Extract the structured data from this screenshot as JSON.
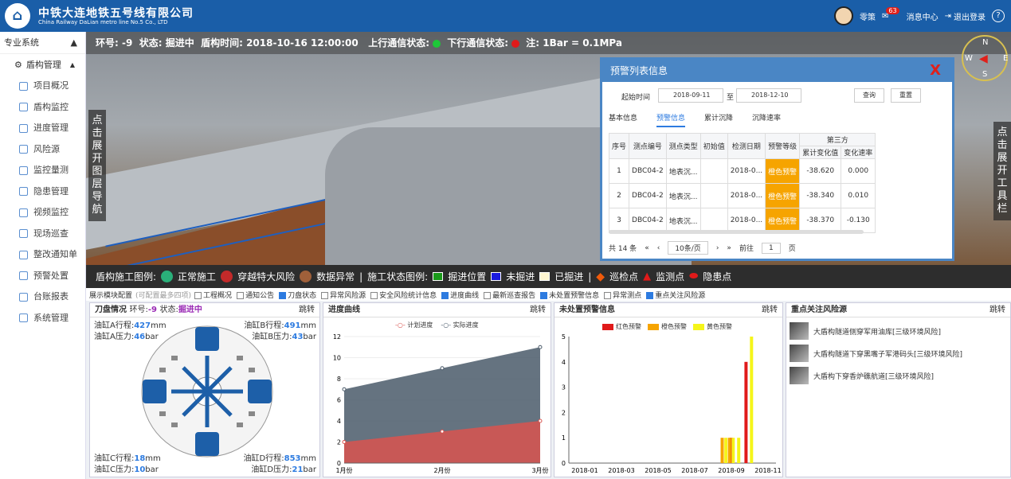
{
  "header": {
    "logo_glyph": "⌂",
    "brand_cn": "中铁大连地铁五号线有限公司",
    "brand_en": "China Railway DaLian metro line No.5 Co., LTD",
    "user": "零策",
    "msg_label": "消息中心",
    "msg_count": "63",
    "logout": "退出登录",
    "help": "?"
  },
  "sidebar": {
    "top": "专业系统",
    "top_arrow": "▲",
    "group": "盾构管理",
    "group_arrow": "▲",
    "items": [
      "项目概况",
      "盾构监控",
      "进度管理",
      "风险源",
      "监控量测",
      "隐患管理",
      "视频监控",
      "现场巡查",
      "整改通知单",
      "预警处置",
      "台账报表",
      "系统管理"
    ]
  },
  "info": {
    "ring_label": "环号:",
    "ring": "-9",
    "state_label": "状态:",
    "state": "掘进中",
    "time_label": "盾构时间:",
    "time": "2018-10-16 12:00:00",
    "up_label": "上行通信状态:",
    "down_label": "下行通信状态:",
    "note_label": "注:",
    "note": "1Bar = 0.1MPa",
    "up_color": "#1ec738",
    "down_color": "#e01a1a"
  },
  "left_tab": "点击展开图层导航",
  "right_tab": "点击展开工具栏",
  "compass": {
    "n": "N",
    "s": "S",
    "w": "W",
    "e": "E"
  },
  "legend": {
    "construction_label": "盾构施工图例:",
    "normal": "正常施工",
    "risk": "穿越特大风险",
    "abnormal": "数据异常",
    "sep": "|",
    "state_label": "施工状态图例:",
    "pos": "掘进位置",
    "undone": "未掘进",
    "done": "已掘进",
    "sep2": "|",
    "patrol": "巡检点",
    "monitor": "监测点",
    "hazard": "隐患点"
  },
  "config": {
    "title": "展示模块配置",
    "hint": "(可配置最多四项)",
    "items": [
      {
        "label": "工程概况",
        "on": false
      },
      {
        "label": "通知公告",
        "on": false
      },
      {
        "label": "刀盘状态",
        "on": true
      },
      {
        "label": "异常风险源",
        "on": false
      },
      {
        "label": "安全风险统计信息",
        "on": false
      },
      {
        "label": "进度曲线",
        "on": true
      },
      {
        "label": "最新巡查报告",
        "on": false
      },
      {
        "label": "未处置预警信息",
        "on": true
      },
      {
        "label": "异常测点",
        "on": false
      },
      {
        "label": "重点关注风险源",
        "on": true
      }
    ]
  },
  "cutter": {
    "title": "刀盘情况",
    "ring_label": "环号:",
    "ring": "-9",
    "state_label": "状态:",
    "state": "掘进中",
    "jump": "跳转",
    "a_stroke_label": "油缸A行程:",
    "a_stroke": "427",
    "b_stroke_label": "油缸B行程:",
    "b_stroke": "491",
    "mm": "mm",
    "a_press_label": "油缸A压力:",
    "a_press": "46",
    "b_press_label": "油缸B压力:",
    "b_press": "43",
    "bar": "bar",
    "c_stroke_label": "油缸C行程:",
    "c_stroke": "18",
    "d_stroke_label": "油缸D行程:",
    "d_stroke": "853",
    "c_press_label": "油缸C压力:",
    "c_press": "10",
    "d_press_label": "油缸D压力:",
    "d_press": "21"
  },
  "progress": {
    "title": "进度曲线",
    "jump": "跳转",
    "legend_plan": "计划进度",
    "legend_actual": "实际进度"
  },
  "warning": {
    "title": "未处置预警信息",
    "jump": "跳转",
    "legend": [
      {
        "name": "红色预警",
        "color": "#e01a1a"
      },
      {
        "name": "橙色预警",
        "color": "#f6a400"
      },
      {
        "name": "黄色预警",
        "color": "#f5f51a"
      }
    ]
  },
  "risks": {
    "title": "重点关注风险源",
    "jump": "跳转",
    "items": [
      "大盾构隧道侧穿军用油库[三级环境风险]",
      "大盾构隧道下穿黑嘴子军港码头[三级环境风险]",
      "大盾构下穿香炉礁航道[三级环境风险]"
    ]
  },
  "popup": {
    "title": "预警列表信息",
    "close": "X",
    "start_label": "起始时间",
    "start": "2018-09-11",
    "to": "至",
    "end": "2018-12-10",
    "query": "查询",
    "reset": "重置",
    "tabs": [
      "基本信息",
      "预警信息",
      "累计沉降",
      "沉降速率"
    ],
    "cols": [
      "序号",
      "测点编号",
      "测点类型",
      "初始值",
      "检测日期",
      "预警等级",
      "第三方",
      "累计变化值",
      "变化速率"
    ],
    "rows": [
      [
        "1",
        "DBC04-2",
        "地表沉...",
        "",
        "2018-0...",
        "橙色预警",
        "-38.620",
        "0.000"
      ],
      [
        "2",
        "DBC04-2",
        "地表沉...",
        "",
        "2018-0...",
        "橙色预警",
        "-38.340",
        "0.010"
      ],
      [
        "3",
        "DBC04-2",
        "地表沉...",
        "",
        "2018-0...",
        "橙色预警",
        "-38.370",
        "-0.130"
      ]
    ],
    "total": "共 14 条",
    "prev2": "«",
    "prev": "‹",
    "page_size": "10条/页",
    "next": "›",
    "next2": "»",
    "goto": "前往",
    "page": "1",
    "page_unit": "页"
  },
  "chart_data": [
    {
      "type": "area",
      "title": "进度曲线",
      "categories": [
        "1月份",
        "2月份",
        "3月份"
      ],
      "series": [
        {
          "name": "计划进度",
          "values": [
            2,
            3,
            4
          ],
          "color": "#d9544f"
        },
        {
          "name": "实际进度",
          "values": [
            7,
            9,
            11
          ],
          "color": "#4a5a6a"
        }
      ],
      "ylim": [
        0,
        12
      ],
      "yticks": [
        0,
        2,
        4,
        6,
        8,
        10,
        12
      ]
    },
    {
      "type": "bar",
      "title": "未处置预警信息",
      "categories": [
        "2018-01",
        "2018-03",
        "2018-05",
        "2018-07",
        "2018-09",
        "2018-11"
      ],
      "series": [
        {
          "name": "红色预警",
          "color": "#e01a1a",
          "points": [
            [
              7.6,
              0
            ],
            [
              8.0,
              1
            ],
            [
              8.8,
              4
            ]
          ]
        },
        {
          "name": "橙色预警",
          "color": "#f6a400",
          "points": [
            [
              7.5,
              1
            ],
            [
              7.9,
              1
            ]
          ]
        },
        {
          "name": "黄色预警",
          "color": "#f5f51a",
          "points": [
            [
              7.7,
              1
            ],
            [
              8.1,
              1
            ],
            [
              8.4,
              1
            ],
            [
              9.1,
              5
            ]
          ]
        }
      ],
      "ylim": [
        0,
        5
      ],
      "yticks": [
        0,
        1,
        2,
        3,
        4,
        5
      ]
    }
  ]
}
